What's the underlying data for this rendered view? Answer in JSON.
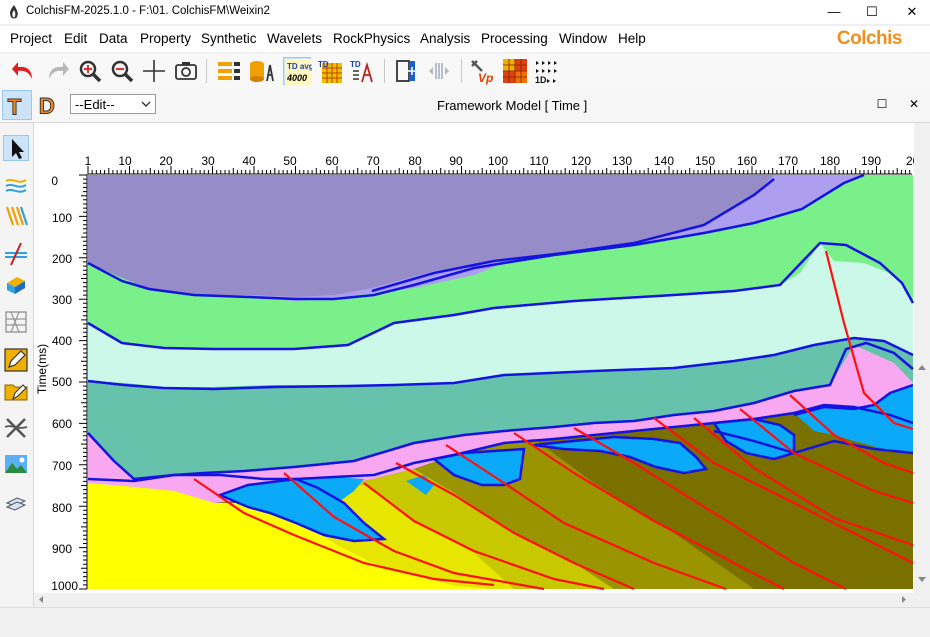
{
  "window": {
    "title": "ColchisFM-2025.1.0 - F:\\01. ColchisFM\\Weixin2",
    "minimize": "—",
    "maximize": "☐",
    "close": "✕"
  },
  "menu": [
    "Project",
    "Edit",
    "Data",
    "Property",
    "Synthetic",
    "Wavelets",
    "RockPhysics",
    "Analysis",
    "Processing",
    "Window",
    "Help"
  ],
  "brand": "Colchis",
  "toolbar": {
    "td_avg_top": "TD avg",
    "td_avg_value": "4000",
    "vp_label": "Vp",
    "oned_label": "1D"
  },
  "panel": {
    "t_label": "T",
    "d_label": "D",
    "mode_value": "--Edit--",
    "title": "Framework Model [ Time ]",
    "maximize": "☐",
    "close": "✕"
  },
  "chart_data": {
    "type": "section",
    "title": "Framework Model [ Time ]",
    "ylabel": "Time(ms)",
    "x_ticks": [
      "1",
      "10",
      "20",
      "30",
      "40",
      "50",
      "60",
      "70",
      "80",
      "90",
      "100",
      "110",
      "120",
      "130",
      "140",
      "150",
      "160",
      "170",
      "180",
      "190",
      "20"
    ],
    "y_ticks": [
      "0",
      "100",
      "200",
      "300",
      "400",
      "500",
      "600",
      "700",
      "800",
      "900",
      "1000"
    ],
    "xlim": [
      1,
      200
    ],
    "ylim": [
      0,
      1000
    ],
    "colors": {
      "layer1": "#968cc8",
      "layer2": "#ae9ef0",
      "layer3": "#7af08a",
      "layer4": "#ccf8ea",
      "layer5": "#66c2aa",
      "layer6": "#f8a8f0",
      "lens": "#0aaaf8",
      "basement": "#ffff00",
      "fault_block_light": "#e6e600",
      "fault_block_mid": "#c8c800",
      "fault_block_dark": "#9a9400",
      "fault_block_darkest": "#7a7000",
      "horizon_line": "#1414e0",
      "fault_line": "#ff1010"
    }
  }
}
